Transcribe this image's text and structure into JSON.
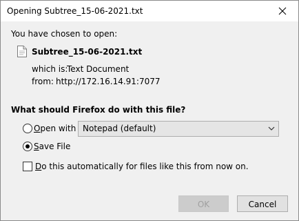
{
  "window": {
    "title": "Opening Subtree_15-06-2021.txt"
  },
  "intro": {
    "chosen_label": "You have chosen to open:",
    "file_name": "Subtree_15-06-2021.txt",
    "which_is_label": "which is:",
    "which_is_value": "Text Document",
    "from_label": "from:",
    "from_value": "http://172.16.14.91:7077"
  },
  "options": {
    "question": "What should Firefox do with this file?",
    "open_with_label_underlined": "O",
    "open_with_label_rest": "pen with",
    "open_with_app": "Notepad (default)",
    "open_with_selected": false,
    "save_file_label_underlined": "S",
    "save_file_label_rest": "ave File",
    "save_file_selected": true,
    "auto_checkbox_label_underlined": "D",
    "auto_checkbox_label_rest": "o this automatically for files like this from now on.",
    "auto_checkbox_checked": false
  },
  "buttons": {
    "ok_label": "OK",
    "ok_enabled": false,
    "cancel_label": "Cancel"
  },
  "icons": {
    "close": "close-icon",
    "file": "document-icon",
    "dropdown": "chevron-down-icon"
  }
}
